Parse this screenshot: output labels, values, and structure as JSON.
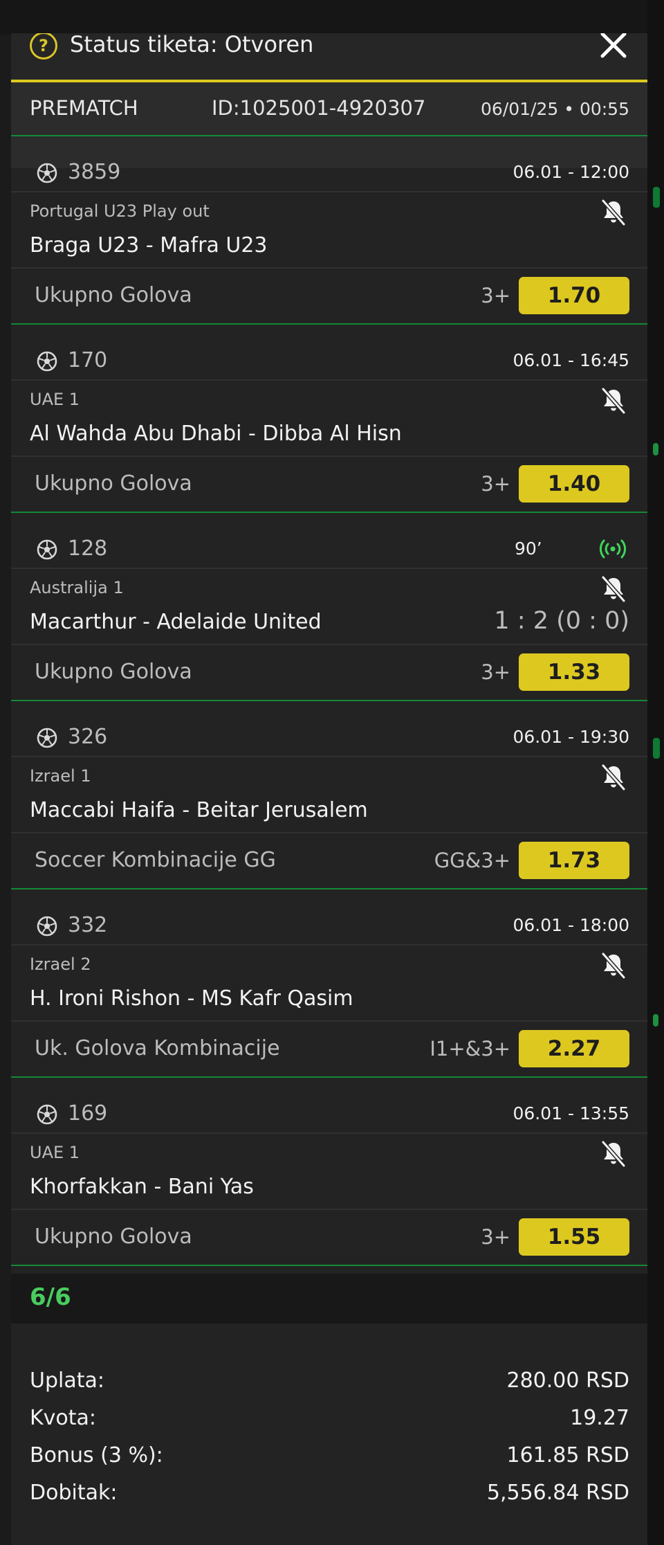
{
  "header": {
    "help_symbol": "?",
    "title": "Status tiketa: Otvoren",
    "close_label": "×"
  },
  "ticket": {
    "type": "PREMATCH",
    "id": "ID:1025001-4920307",
    "datetime": "06/01/25 • 00:55"
  },
  "events": [
    {
      "code": "3859",
      "when": "06.01  -  12:00",
      "league": "Portugal U23 Play out",
      "match": "Braga U23 - Mafra U23",
      "market": "Ukupno Golova",
      "pick": "3+",
      "odd": "1.70"
    },
    {
      "code": "170",
      "when": "06.01  -  16:45",
      "league": "UAE 1",
      "match": "Al Wahda Abu Dhabi - Dibba Al Hisn",
      "market": "Ukupno Golova",
      "pick": "3+",
      "odd": "1.40"
    },
    {
      "code": "128",
      "minute": "90’",
      "league": "Australija 1",
      "match": "Macarthur - Adelaide United",
      "score": "1 : 2 (0 : 0)",
      "market": "Ukupno Golova",
      "pick": "3+",
      "odd": "1.33"
    },
    {
      "code": "326",
      "when": "06.01  -  19:30",
      "league": "Izrael 1",
      "match": "Maccabi Haifa - Beitar Jerusalem",
      "market": "Soccer Kombinacije GG",
      "pick": "GG&3+",
      "odd": "1.73"
    },
    {
      "code": "332",
      "when": "06.01  -  18:00",
      "league": "Izrael 2",
      "match": "H. Ironi Rishon - MS Kafr Qasim",
      "market": "Uk. Golova Kombinacije",
      "pick": "I1+&3+",
      "odd": "2.27"
    },
    {
      "code": "169",
      "when": "06.01  -  13:55",
      "league": "UAE 1",
      "match": "Khorfakkan - Bani Yas",
      "market": "Ukupno Golova",
      "pick": "3+",
      "odd": "1.55"
    }
  ],
  "result_count": "6/6",
  "summary": [
    {
      "label": "Uplata:",
      "value": "280.00 RSD"
    },
    {
      "label": "Kvota:",
      "value": "19.27"
    },
    {
      "label": "Bonus (3 %):",
      "value": "161.85 RSD"
    },
    {
      "label": "Dobitak:",
      "value": "5,556.84 RSD"
    }
  ],
  "colors": {
    "accent_yellow": "#ddc820",
    "status_green": "#49cc5e",
    "sheet_bg": "#232323",
    "live_green": "#3fd65b"
  },
  "icons": {
    "help": "help-circle-icon",
    "close": "close-icon",
    "sport": "soccer-ball-icon",
    "notify": "bell-off-icon",
    "live": "live-broadcast-icon"
  }
}
